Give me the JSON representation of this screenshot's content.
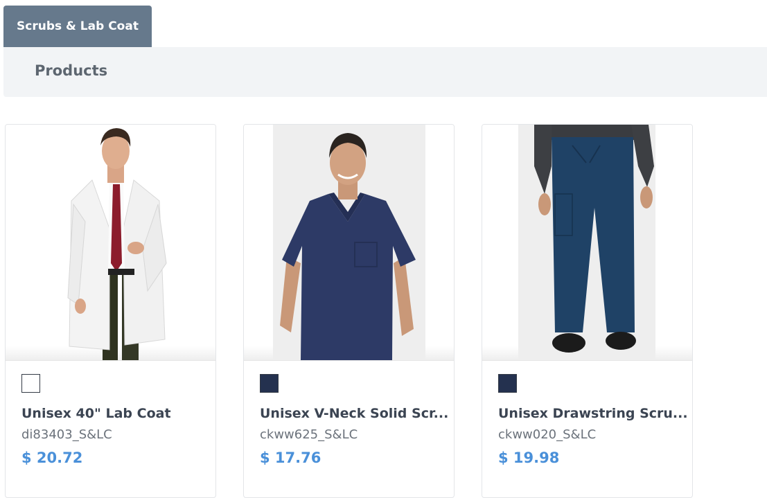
{
  "tab": {
    "label": "Scrubs & Lab Coat"
  },
  "section": {
    "title": "Products"
  },
  "products": [
    {
      "name": "Unisex 40\" Lab Coat",
      "sku": "di83403_S&LC",
      "price": "$ 20.72",
      "color": "#ffffff",
      "image": "lab-coat-model"
    },
    {
      "name": "Unisex V-Neck Solid Scr...",
      "sku": "ckww625_S&LC",
      "price": "$ 17.76",
      "color": "#24314f",
      "image": "vneck-scrub-top-model"
    },
    {
      "name": "Unisex Drawstring Scru...",
      "sku": "ckww020_S&LC",
      "price": "$ 19.98",
      "color": "#24314f",
      "image": "drawstring-scrub-pants-model"
    }
  ],
  "colors": {
    "tab_bg": "#66798c",
    "price": "#4a90d9",
    "products_bar": "#f2f4f6"
  }
}
